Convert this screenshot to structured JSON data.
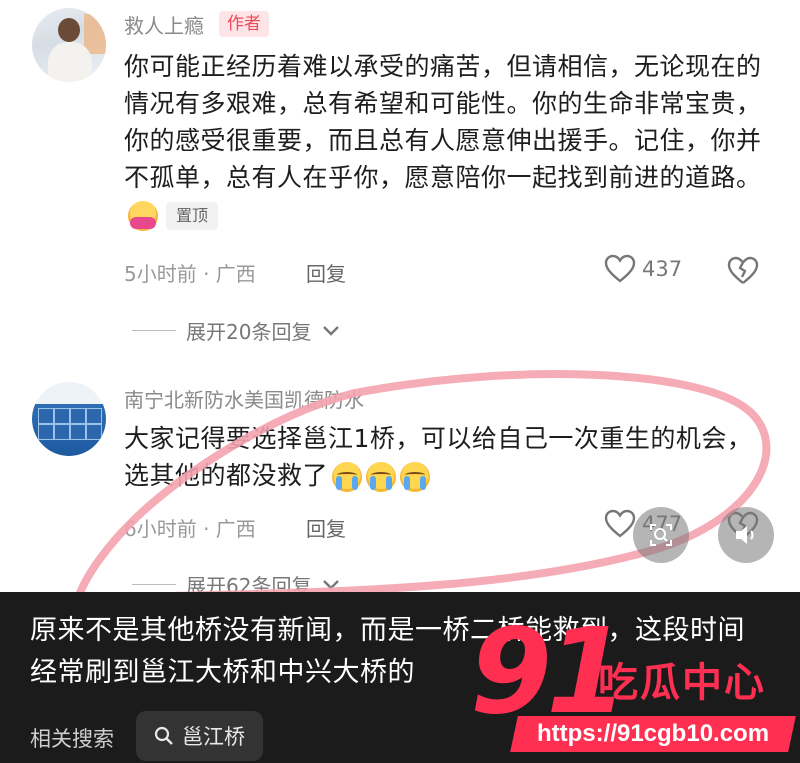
{
  "comments": [
    {
      "username": "救人上瘾",
      "author_badge": "作者",
      "text": "你可能正经历着难以承受的痛苦，但请相信，无论现在的情况有多艰难，总有希望和可能性。你的生命非常宝贵，你的感受很重要，而且总有人愿意伸出援手。记住，你并不孤单，总有人在乎你，愿意陪你一起找到前进的道路。",
      "pinned_label": "置顶",
      "emoji": "hugging-face-emoji",
      "time_location": "5小时前 · 广西",
      "reply_label": "回复",
      "like_count": "437",
      "expand_label": "展开20条回复"
    },
    {
      "username": "南宁北新防水美国凯德防水",
      "text": "大家记得要选择邕江1桥，可以给自己一次重生的机会，选其他的都没救了",
      "emoji": "crying-face-emoji",
      "time_location": "6小时前 · 广西",
      "reply_label": "回复",
      "like_count": "477",
      "expand_label": "展开62条回复"
    }
  ],
  "bottom_panel": {
    "text": "原来不是其他桥没有新闻，而是一桥二桥能救到，这段时间经常刷到邕江大桥和中兴大桥的",
    "related_label": "相关搜索",
    "search_chip": "邕江桥"
  },
  "watermark": {
    "number": "91",
    "name": "吃瓜中心",
    "url": "https://91cgb10.com"
  },
  "colors": {
    "accent_red": "#ff2f52",
    "badge_bg": "#fde4e6",
    "panel_bg": "#1b1b1b"
  },
  "icons": [
    "heart-outline-icon",
    "broken-heart-icon",
    "chevron-down-icon",
    "search-icon",
    "lens-search-icon",
    "speaker-icon"
  ]
}
